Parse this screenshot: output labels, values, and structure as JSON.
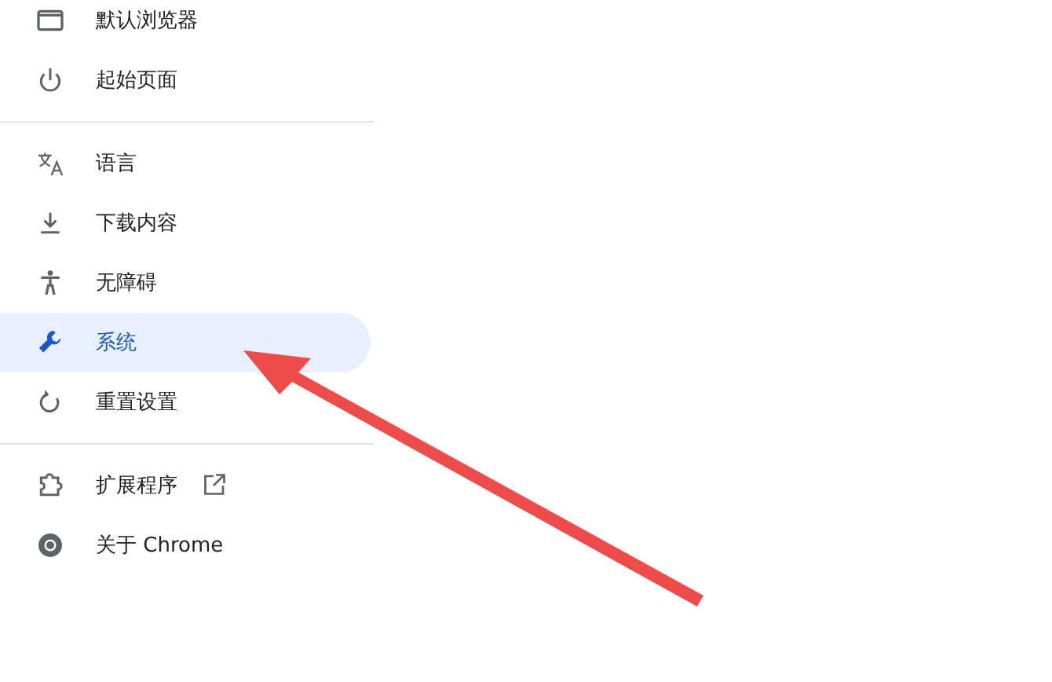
{
  "sidebar": {
    "groups": [
      {
        "items": [
          {
            "kind": "browser",
            "label": "默认浏览器",
            "selected": false
          },
          {
            "kind": "power",
            "label": "起始页面",
            "selected": false
          }
        ]
      },
      {
        "items": [
          {
            "kind": "translate",
            "label": "语言",
            "selected": false
          },
          {
            "kind": "download",
            "label": "下载内容",
            "selected": false
          },
          {
            "kind": "accessibility",
            "label": "无障碍",
            "selected": false
          },
          {
            "kind": "wrench",
            "label": "系统",
            "selected": true
          },
          {
            "kind": "reset",
            "label": "重置设置",
            "selected": false
          }
        ]
      },
      {
        "items": [
          {
            "kind": "puzzle",
            "label": "扩展程序",
            "selected": false,
            "external": true
          },
          {
            "kind": "chrome",
            "label": "关于 Chrome",
            "selected": false
          }
        ]
      }
    ]
  }
}
